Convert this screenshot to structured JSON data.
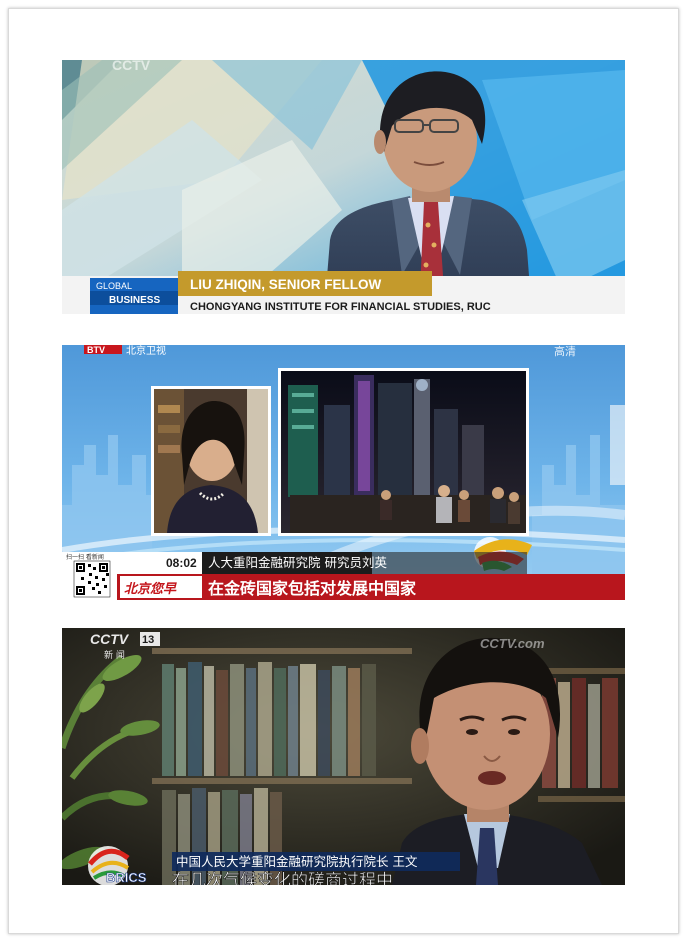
{
  "panel1": {
    "watermark": "CCTV",
    "show_line1": "GLOBAL",
    "show_line2": "BUSINESS",
    "name_title": "LIU ZHIQIN, SENIOR FELLOW",
    "affiliation": "CHONGYANG INSTITUTE FOR FINANCIAL STUDIES, RUC"
  },
  "panel2": {
    "channel_logo": "BTV",
    "channel_name": "北京卫视",
    "hd_mark": "高清",
    "qr_caption": "扫一扫 看新闻",
    "time": "08:02",
    "caption": "人大重阳金融研究院 研究员刘英",
    "program": "北京您早",
    "subtitle": "在金砖国家包括对发展中国家"
  },
  "panel3": {
    "channel_logo": "CCTV",
    "channel_number": "13",
    "channel_sub": "新 闻",
    "watermark": "CCTV.com",
    "caption": "中国人民大学重阳金融研究院执行院长 王文",
    "brics_logo": "BRICS",
    "subtitle": "在几次气候变化的磋商过程中"
  }
}
